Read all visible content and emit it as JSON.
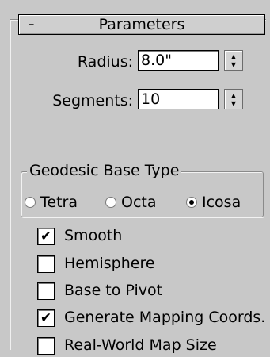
{
  "rollout": {
    "collapse_symbol": "-",
    "title": "Parameters"
  },
  "radius": {
    "label": "Radius:",
    "value": "8.0\"",
    "spinner_up": "▲",
    "spinner_down": "▼"
  },
  "segments": {
    "label": "Segments:",
    "value": "10",
    "spinner_up": "▲",
    "spinner_down": "▼"
  },
  "geodesic": {
    "title": "Geodesic Base Type",
    "options": [
      {
        "label": "Tetra",
        "selected": false
      },
      {
        "label": "Octa",
        "selected": false
      },
      {
        "label": "Icosa",
        "selected": true
      }
    ]
  },
  "checkboxes": [
    {
      "label": "Smooth",
      "checked": true,
      "mark": "✔"
    },
    {
      "label": "Hemisphere",
      "checked": false,
      "mark": ""
    },
    {
      "label": "Base to Pivot",
      "checked": false,
      "mark": ""
    },
    {
      "label": "Generate Mapping Coords.",
      "checked": true,
      "mark": "✔"
    },
    {
      "label": "Real-World Map Size",
      "checked": false,
      "mark": ""
    }
  ]
}
